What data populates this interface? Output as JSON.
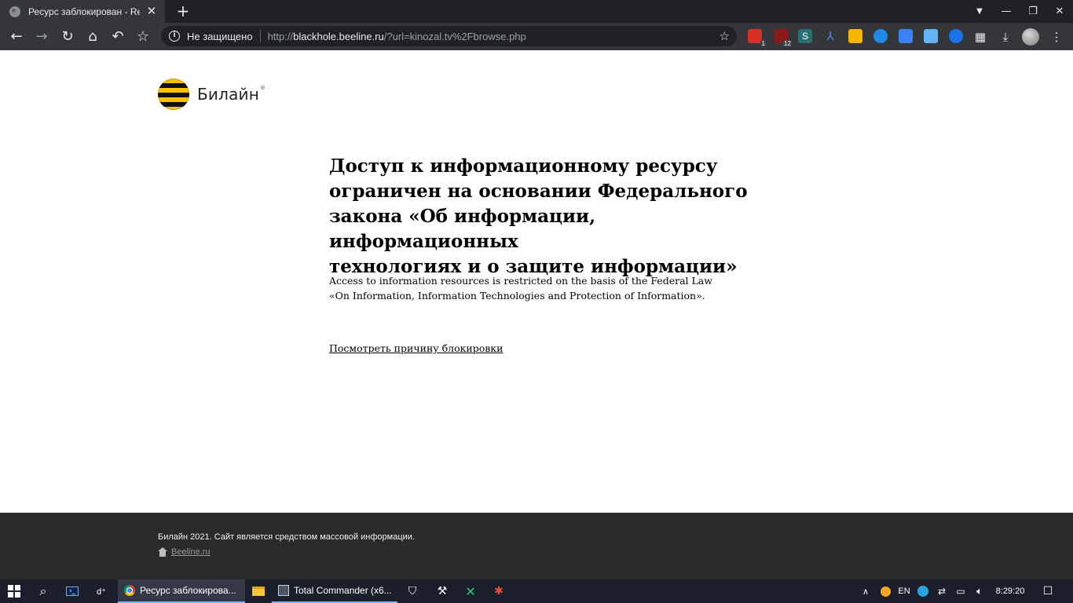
{
  "browser": {
    "tab_title": "Ресурс заблокирован - Re",
    "new_tab": "+",
    "security_label": "Не защищено",
    "url_scheme": "http://",
    "url_host": "blackhole.beeline.ru",
    "url_rest": "/?url=kinozal.tv%2Fbrowse.php",
    "extension_badges": [
      "1",
      "12"
    ],
    "icons": {
      "back": "arrow-left-icon",
      "forward": "arrow-right-icon",
      "reload": "reload-icon",
      "home": "home-icon",
      "undo": "undo-icon",
      "bookmarks": "star-icon",
      "downloads": "download-icon",
      "extensions_menu": "grid-icon"
    }
  },
  "page": {
    "logo_text": "Билайн",
    "logo_mark": "®",
    "heading_lines": [
      "Доступ к информационному ресурсу",
      "ограничен на основании Федерального",
      "закона «Об информации, информационных",
      "технологиях и о защите информации»"
    ],
    "subtext_lines": [
      "Access to information resources is restricted on the basis of the Federal Law",
      "«On Information, Information Technologies and Protection of Information»."
    ],
    "block_reason_link": "Посмотреть причину блокировки",
    "colors": {
      "brand_yellow": "#fec100",
      "brand_black": "#111111"
    }
  },
  "footer": {
    "copyright": "Билайн 2021. Сайт является средством массовой информации.",
    "home_link": "Beeline.ru"
  },
  "taskbar": {
    "chrome_task": "Ресурс заблокирова...",
    "tc_task": "Total Commander (x6...",
    "dl_label": "d⁺",
    "language": "EN",
    "clock": "8:29:20"
  }
}
